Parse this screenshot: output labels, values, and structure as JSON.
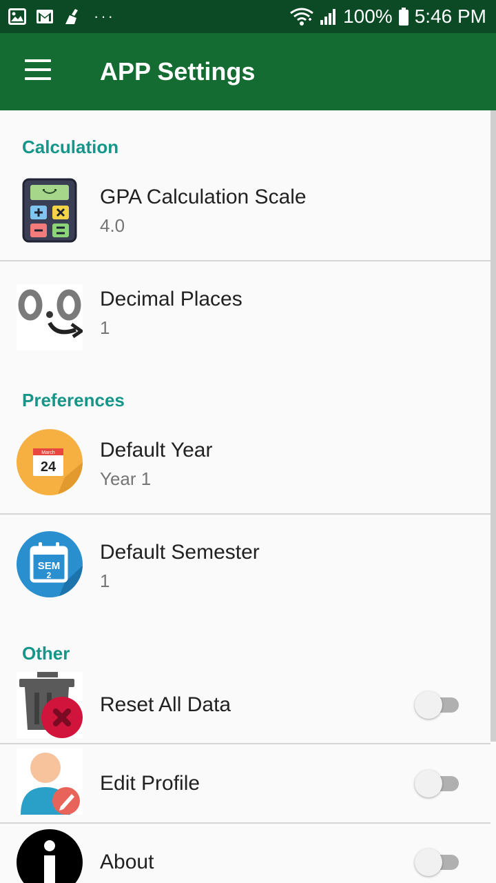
{
  "status_bar": {
    "left_icons": [
      "gallery-icon",
      "gmail-icon",
      "cleaner-icon"
    ],
    "more_indicator": "···",
    "battery": "100%",
    "time": "5:46 PM"
  },
  "app_bar": {
    "title": "APP Settings",
    "menu_icon": "hamburger-menu-icon"
  },
  "sections": {
    "calculation": {
      "header": "Calculation",
      "items": [
        {
          "title": "GPA Calculation Scale",
          "value": "4.0",
          "icon": "calculator-icon"
        },
        {
          "title": "Decimal Places",
          "value": "1",
          "icon": "decimal-places-icon"
        }
      ]
    },
    "preferences": {
      "header": "Preferences",
      "items": [
        {
          "title": "Default Year",
          "value": "Year 1",
          "icon": "calendar-icon",
          "icon_text_month": "March",
          "icon_text_day": "24"
        },
        {
          "title": "Default Semester",
          "value": "1",
          "icon": "semester-calendar-icon",
          "icon_text_sem": "SEM",
          "icon_text_num": "2"
        }
      ]
    },
    "other": {
      "header": "Other",
      "items": [
        {
          "title": "Reset All Data",
          "icon": "trash-delete-icon",
          "toggle_on": false
        },
        {
          "title": "Edit Profile",
          "icon": "user-edit-icon",
          "toggle_on": false
        },
        {
          "title": "About",
          "icon": "info-icon",
          "toggle_on": false
        }
      ]
    }
  },
  "colors": {
    "status_bar": "#0b4a25",
    "app_bar": "#146c32",
    "section_header": "#159688",
    "background": "#fafafa"
  }
}
